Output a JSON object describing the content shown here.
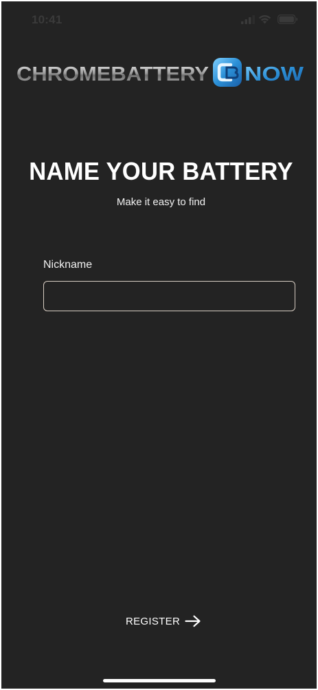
{
  "status_bar": {
    "time": "10:41"
  },
  "logo": {
    "wordmark_left": "CHROMEBATTERY",
    "wordmark_right": "NOW",
    "brand_colors": {
      "chrome": "#9a9a9a",
      "accent": "#3aa3e0"
    }
  },
  "header": {
    "title": "NAME YOUR BATTERY",
    "subtitle": "Make it easy to find"
  },
  "form": {
    "nickname_label": "Nickname",
    "nickname_value": "",
    "nickname_placeholder": ""
  },
  "actions": {
    "register_label": "REGISTER",
    "register_icon": "arrow-right-icon"
  },
  "theme": {
    "background": "#232323",
    "text": "#ffffff",
    "input_border": "#d9cfc4"
  }
}
